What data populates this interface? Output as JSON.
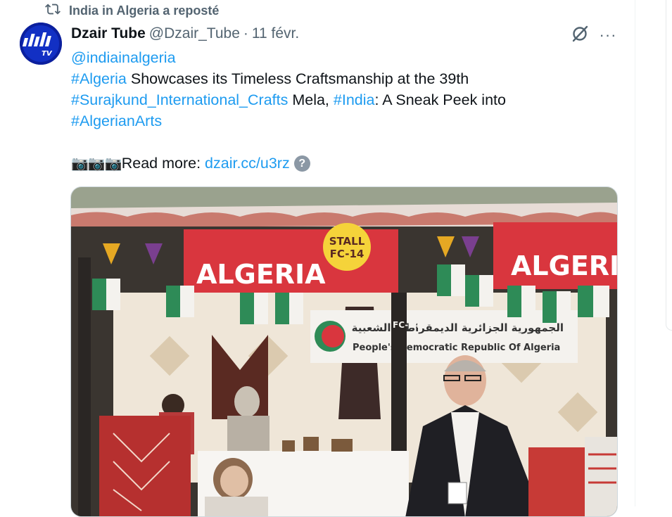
{
  "repost": {
    "text": "India in Algeria a reposté",
    "icon": "repost-icon"
  },
  "tweet": {
    "author_name": "Dzair Tube",
    "author_handle": "@Dzair_Tube",
    "separator": "·",
    "date": "11 févr.",
    "avatar_label": "TV",
    "mention": "@indiainalgeria",
    "line2_tag": "#Algeria",
    "line2_text": " Showcases its Timeless Craftsmanship at the 39th",
    "line3_tag1": "#Surajkund_International_Crafts",
    "line3_text1": " Mela, ",
    "line3_tag2": "#India",
    "line3_text2": ": A Sneak Peek into",
    "line4_tag": "#AlgerianArts",
    "cameras": "📷📷📷",
    "read_more": "Read more: ",
    "link": "dzair.cc/u3rz",
    "help_mark": "?"
  },
  "actions": {
    "more": "···",
    "grok_icon": "grok-icon"
  },
  "photo": {
    "sign_left": "ALGERIA",
    "stall_line1": "STALL",
    "stall_line2": "FC-14",
    "sign_right": "ALGERI",
    "banner_arabic": "الجمهورية الجزائرية الديمقراطية الشعبية",
    "banner_french": "People's Democratic Republic Of Algeria",
    "pillar_text": "FC-14"
  },
  "colors": {
    "link": "#1d9bf0",
    "text": "#0f1419",
    "muted": "#536471",
    "sign_red": "#d9363e",
    "stall_yellow": "#f5d33a"
  }
}
